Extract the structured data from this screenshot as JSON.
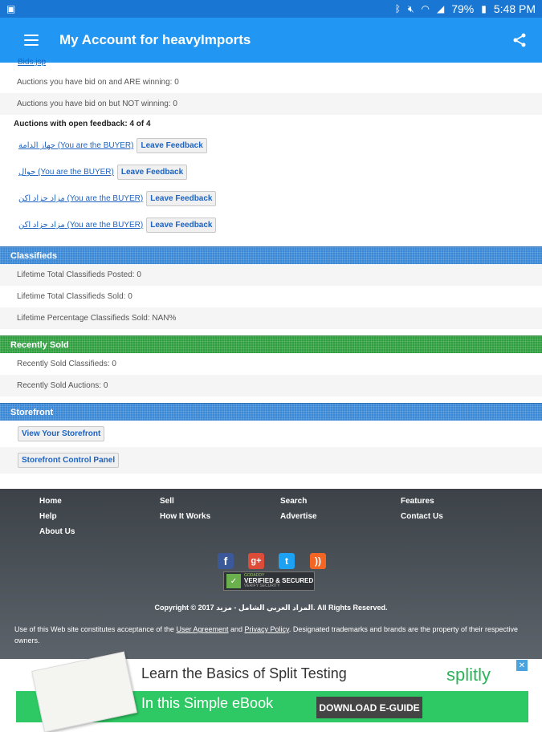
{
  "status_bar": {
    "battery": "79%",
    "time": "5:48 PM"
  },
  "app_bar": {
    "title": "My Account for heavyImports"
  },
  "auctions": {
    "cut_link": "Bids.jsp",
    "winning": "Auctions you have bid on and ARE winning: 0",
    "not_winning": "Auctions you have bid on but NOT winning: 0",
    "open_feedback": "Auctions with open feedback: 4 of 4",
    "feedback_items": [
      {
        "link": "جهاز الدامة (You are the BUYER)",
        "button": "Leave Feedback"
      },
      {
        "link": "جوال (You are the BUYER)",
        "button": "Leave Feedback"
      },
      {
        "link": "مزاد جزاد اكن (You are the BUYER)",
        "button": "Leave Feedback"
      },
      {
        "link": "مزاد جزاد اكن (You are the BUYER)",
        "button": "Leave Feedback"
      }
    ]
  },
  "classifieds": {
    "heading": "Classifieds",
    "posted": "Lifetime Total Classifieds Posted: 0",
    "sold": "Lifetime Total Classifieds Sold: 0",
    "percentage": "Lifetime Percentage Classifieds Sold: NAN%"
  },
  "recently_sold": {
    "heading": "Recently Sold",
    "classifieds": "Recently Sold Classifieds: 0",
    "auctions": "Recently Sold Auctions: 0"
  },
  "storefront": {
    "heading": "Storefront",
    "view_button": "View Your Storefront",
    "control_button": "Storefront Control Panel"
  },
  "footer": {
    "links": [
      "Home",
      "Sell",
      "Search",
      "Features",
      "Help",
      "How It Works",
      "Advertise",
      "Contact Us",
      "About Us"
    ],
    "verified": {
      "top": "GODADDY",
      "mid": "VERIFIED & SECURED",
      "bot": "VERIFY SECURITY"
    },
    "copyright": "Copyright © 2017 المزاد العربي الشامل - مزيد. All Rights Reserved.",
    "terms_pre": "Use of this Web site constitutes acceptance of the ",
    "user_agreement": "User Agreement",
    "and": " and ",
    "privacy_policy": "Privacy Policy",
    "terms_post": ". Designated trademarks and brands are the property of their respective owners."
  },
  "ad": {
    "title": "Learn the Basics of Split Testing",
    "subtitle": "In this Simple eBook",
    "cta": "DOWNLOAD E-GUIDE",
    "brand": "splitly"
  },
  "colors": {
    "status_bar": "#1976d2",
    "app_bar": "#2196f3",
    "section_blue": "#3a87d6",
    "section_green": "#2e9e3e",
    "ad_green": "#2ec964"
  }
}
